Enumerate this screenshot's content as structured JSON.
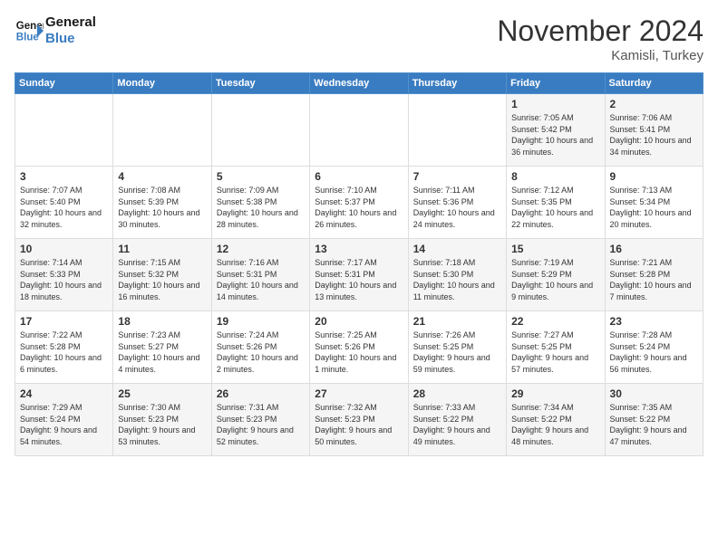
{
  "header": {
    "logo_line1": "General",
    "logo_line2": "Blue",
    "month": "November 2024",
    "location": "Kamisli, Turkey"
  },
  "days_of_week": [
    "Sunday",
    "Monday",
    "Tuesday",
    "Wednesday",
    "Thursday",
    "Friday",
    "Saturday"
  ],
  "weeks": [
    [
      {
        "day": "",
        "info": ""
      },
      {
        "day": "",
        "info": ""
      },
      {
        "day": "",
        "info": ""
      },
      {
        "day": "",
        "info": ""
      },
      {
        "day": "",
        "info": ""
      },
      {
        "day": "1",
        "info": "Sunrise: 7:05 AM\nSunset: 5:42 PM\nDaylight: 10 hours and 36 minutes."
      },
      {
        "day": "2",
        "info": "Sunrise: 7:06 AM\nSunset: 5:41 PM\nDaylight: 10 hours and 34 minutes."
      }
    ],
    [
      {
        "day": "3",
        "info": "Sunrise: 7:07 AM\nSunset: 5:40 PM\nDaylight: 10 hours and 32 minutes."
      },
      {
        "day": "4",
        "info": "Sunrise: 7:08 AM\nSunset: 5:39 PM\nDaylight: 10 hours and 30 minutes."
      },
      {
        "day": "5",
        "info": "Sunrise: 7:09 AM\nSunset: 5:38 PM\nDaylight: 10 hours and 28 minutes."
      },
      {
        "day": "6",
        "info": "Sunrise: 7:10 AM\nSunset: 5:37 PM\nDaylight: 10 hours and 26 minutes."
      },
      {
        "day": "7",
        "info": "Sunrise: 7:11 AM\nSunset: 5:36 PM\nDaylight: 10 hours and 24 minutes."
      },
      {
        "day": "8",
        "info": "Sunrise: 7:12 AM\nSunset: 5:35 PM\nDaylight: 10 hours and 22 minutes."
      },
      {
        "day": "9",
        "info": "Sunrise: 7:13 AM\nSunset: 5:34 PM\nDaylight: 10 hours and 20 minutes."
      }
    ],
    [
      {
        "day": "10",
        "info": "Sunrise: 7:14 AM\nSunset: 5:33 PM\nDaylight: 10 hours and 18 minutes."
      },
      {
        "day": "11",
        "info": "Sunrise: 7:15 AM\nSunset: 5:32 PM\nDaylight: 10 hours and 16 minutes."
      },
      {
        "day": "12",
        "info": "Sunrise: 7:16 AM\nSunset: 5:31 PM\nDaylight: 10 hours and 14 minutes."
      },
      {
        "day": "13",
        "info": "Sunrise: 7:17 AM\nSunset: 5:31 PM\nDaylight: 10 hours and 13 minutes."
      },
      {
        "day": "14",
        "info": "Sunrise: 7:18 AM\nSunset: 5:30 PM\nDaylight: 10 hours and 11 minutes."
      },
      {
        "day": "15",
        "info": "Sunrise: 7:19 AM\nSunset: 5:29 PM\nDaylight: 10 hours and 9 minutes."
      },
      {
        "day": "16",
        "info": "Sunrise: 7:21 AM\nSunset: 5:28 PM\nDaylight: 10 hours and 7 minutes."
      }
    ],
    [
      {
        "day": "17",
        "info": "Sunrise: 7:22 AM\nSunset: 5:28 PM\nDaylight: 10 hours and 6 minutes."
      },
      {
        "day": "18",
        "info": "Sunrise: 7:23 AM\nSunset: 5:27 PM\nDaylight: 10 hours and 4 minutes."
      },
      {
        "day": "19",
        "info": "Sunrise: 7:24 AM\nSunset: 5:26 PM\nDaylight: 10 hours and 2 minutes."
      },
      {
        "day": "20",
        "info": "Sunrise: 7:25 AM\nSunset: 5:26 PM\nDaylight: 10 hours and 1 minute."
      },
      {
        "day": "21",
        "info": "Sunrise: 7:26 AM\nSunset: 5:25 PM\nDaylight: 9 hours and 59 minutes."
      },
      {
        "day": "22",
        "info": "Sunrise: 7:27 AM\nSunset: 5:25 PM\nDaylight: 9 hours and 57 minutes."
      },
      {
        "day": "23",
        "info": "Sunrise: 7:28 AM\nSunset: 5:24 PM\nDaylight: 9 hours and 56 minutes."
      }
    ],
    [
      {
        "day": "24",
        "info": "Sunrise: 7:29 AM\nSunset: 5:24 PM\nDaylight: 9 hours and 54 minutes."
      },
      {
        "day": "25",
        "info": "Sunrise: 7:30 AM\nSunset: 5:23 PM\nDaylight: 9 hours and 53 minutes."
      },
      {
        "day": "26",
        "info": "Sunrise: 7:31 AM\nSunset: 5:23 PM\nDaylight: 9 hours and 52 minutes."
      },
      {
        "day": "27",
        "info": "Sunrise: 7:32 AM\nSunset: 5:23 PM\nDaylight: 9 hours and 50 minutes."
      },
      {
        "day": "28",
        "info": "Sunrise: 7:33 AM\nSunset: 5:22 PM\nDaylight: 9 hours and 49 minutes."
      },
      {
        "day": "29",
        "info": "Sunrise: 7:34 AM\nSunset: 5:22 PM\nDaylight: 9 hours and 48 minutes."
      },
      {
        "day": "30",
        "info": "Sunrise: 7:35 AM\nSunset: 5:22 PM\nDaylight: 9 hours and 47 minutes."
      }
    ]
  ]
}
